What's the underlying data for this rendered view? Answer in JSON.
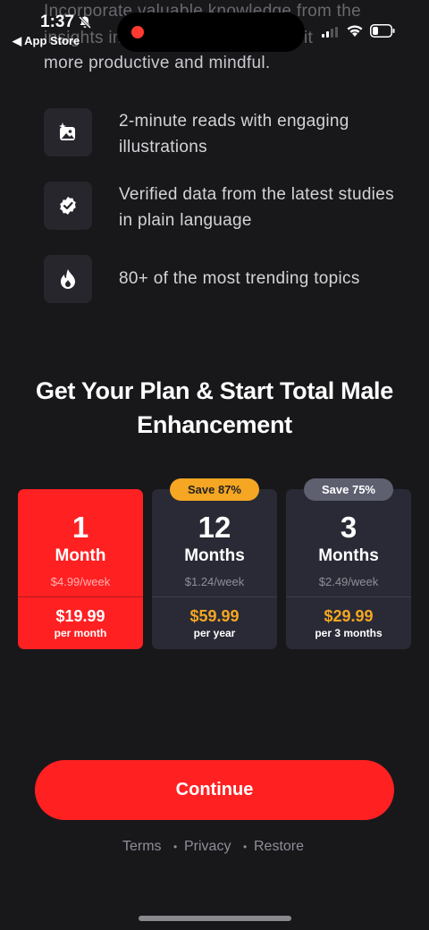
{
  "status_bar": {
    "time": "1:37",
    "back_label": "◀ App Store"
  },
  "intro": {
    "line1": "Incorporate valuable knowledge from the",
    "line2": "insights in",
    "line2b": "make it",
    "line3": "more productive and mindful."
  },
  "features": [
    {
      "icon": "image-sparkle-icon",
      "text": "2-minute reads with engaging illustrations"
    },
    {
      "icon": "verified-badge-icon",
      "text": "Verified data from the latest studies in plain language"
    },
    {
      "icon": "flame-icon",
      "text": "80+ of the most trending topics"
    }
  ],
  "headline": "Get Your Plan & Start Total Male Enhancement",
  "plans": [
    {
      "number": "1",
      "unit": "Month",
      "per_week": "$4.99/week",
      "price": "$19.99",
      "period": "per month",
      "badge": "",
      "selected": true
    },
    {
      "number": "12",
      "unit": "Months",
      "per_week": "$1.24/week",
      "price": "$59.99",
      "period": "per year",
      "badge": "Save 87%",
      "selected": false
    },
    {
      "number": "3",
      "unit": "Months",
      "per_week": "$2.49/week",
      "price": "$29.99",
      "period": "per 3 months",
      "badge": "Save 75%",
      "selected": false
    }
  ],
  "continue_label": "Continue",
  "footer_links": {
    "terms": "Terms",
    "privacy": "Privacy",
    "restore": "Restore",
    "separator": "•"
  },
  "colors": {
    "accent": "#ff2022",
    "badge_orange": "#f5a623",
    "background": "#18181b",
    "card": "#292a35"
  }
}
